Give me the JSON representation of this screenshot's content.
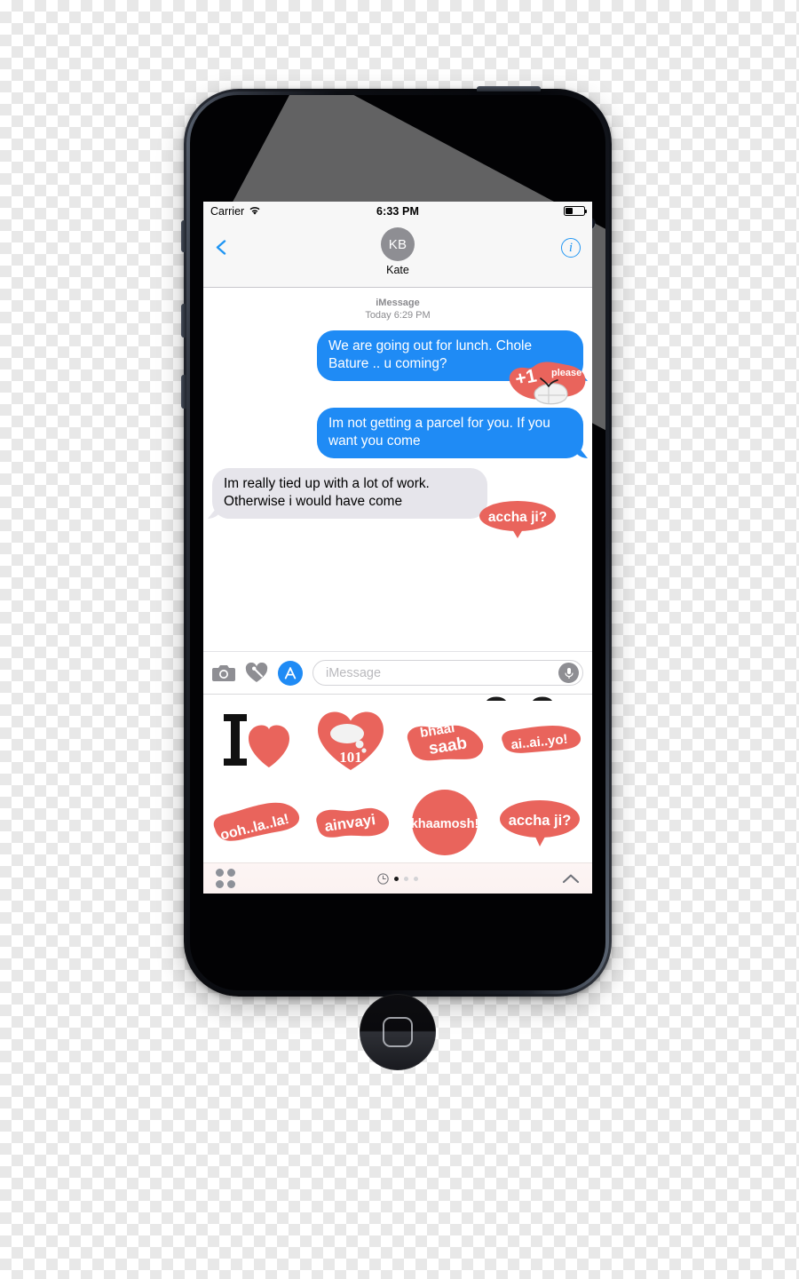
{
  "device": {
    "name": "iPhone 5s Space Gray",
    "hardware": {
      "earpiece": "earpiece-speaker",
      "camera": "front-camera",
      "home": "home-button",
      "mute_switch": "mute-switch",
      "volume_up": "volume-up-button",
      "volume_down": "volume-down-button",
      "power": "power-button"
    }
  },
  "status_bar": {
    "carrier": "Carrier",
    "wifi_icon": "wifi-icon",
    "time": "6:33 PM",
    "battery_icon": "battery-icon",
    "battery_level_pct": 42
  },
  "nav_bar": {
    "back_icon": "chevron-left-icon",
    "avatar_initials": "KB",
    "contact_name": "Kate",
    "info_icon": "info-circle-icon"
  },
  "conversation": {
    "service_label": "iMessage",
    "timestamp": "Today 6:29 PM",
    "messages": [
      {
        "id": "msg-1",
        "direction": "outgoing",
        "text": "We are going out for lunch. Chole Bature .. u coming?",
        "sticker": {
          "name": "plus-one-please-sticker",
          "primary_text": "+1",
          "secondary_text": "please"
        }
      },
      {
        "id": "msg-2",
        "direction": "outgoing",
        "text": "Im not getting a parcel for you. If you want you come",
        "sticker": null
      },
      {
        "id": "msg-3",
        "direction": "incoming",
        "text": "Im really tied up with a lot of work. Otherwise i would have come",
        "sticker": {
          "name": "accha-ji-sticker",
          "primary_text": "accha ji?",
          "secondary_text": ""
        }
      }
    ]
  },
  "input_bar": {
    "camera_icon": "camera-icon",
    "digital_touch_icon": "digital-touch-heart-icon",
    "app_store_icon": "app-store-icon",
    "placeholder": "iMessage",
    "value": "",
    "mic_icon": "microphone-icon"
  },
  "sticker_drawer": {
    "stickers": [
      {
        "id": "sticker-i-heart",
        "label": "I",
        "shape": "i-heart",
        "name": "i-heart-sticker"
      },
      {
        "id": "sticker-101",
        "label": "101",
        "shape": "heart-101",
        "name": "heart-101-sticker"
      },
      {
        "id": "sticker-bhaai-saab",
        "label": "bhaai saab",
        "shape": "blob",
        "name": "bhaai-saab-sticker"
      },
      {
        "id": "sticker-ai-ai-yo",
        "label": "ai..ai..yo!",
        "shape": "blob",
        "name": "ai-ai-yo-sticker"
      },
      {
        "id": "sticker-ooh-la-la",
        "label": "ooh..la..la!",
        "shape": "blob",
        "name": "ooh-la-la-sticker"
      },
      {
        "id": "sticker-ainvayi",
        "label": "ainvayi",
        "shape": "blob",
        "name": "ainvayi-sticker"
      },
      {
        "id": "sticker-khaamosh",
        "label": "khaamosh!",
        "shape": "circle",
        "name": "khaamosh-sticker"
      },
      {
        "id": "sticker-accha-ji",
        "label": "accha ji?",
        "shape": "bubble",
        "name": "accha-ji-drawer-sticker"
      }
    ],
    "toolbar": {
      "grid_icon": "app-grid-icon",
      "recents_icon": "recents-clock-icon",
      "page_count": 3,
      "page_active_index": 0,
      "expand_icon": "chevron-up-icon"
    }
  },
  "colors": {
    "outgoing_bubble": "#1f8bf5",
    "incoming_bubble": "#e6e5eb",
    "sticker_red": "#e9645c",
    "accent_blue": "#2196f3",
    "avatar_gray": "#8e8e93",
    "status_bar_bg": "#f7f7f7"
  }
}
